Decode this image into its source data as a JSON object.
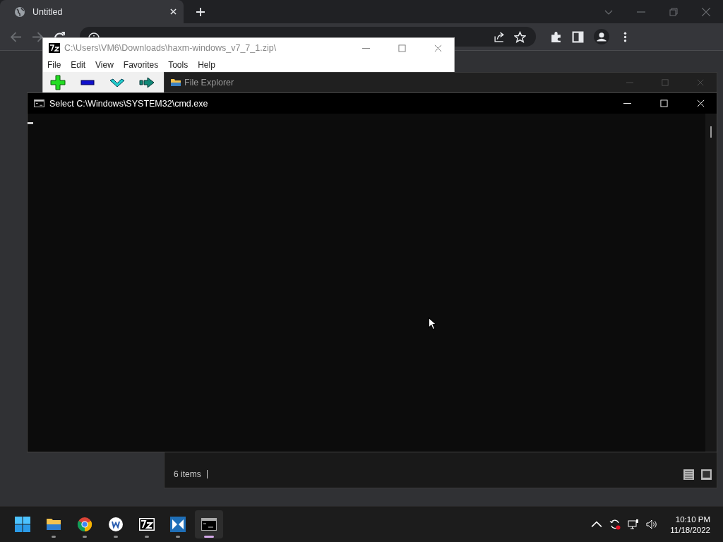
{
  "browser": {
    "tab": {
      "title": "Untitled",
      "selected": true
    }
  },
  "archive_window": {
    "title": "C:\\Users\\VM6\\Downloads\\haxm-windows_v7_7_1.zip\\",
    "menu": [
      "File",
      "Edit",
      "View",
      "Favorites",
      "Tools",
      "Help"
    ]
  },
  "explorer_window": {
    "title": "File Explorer",
    "status": "6 items"
  },
  "console_window": {
    "title": "Select C:\\Windows\\SYSTEM32\\cmd.exe"
  },
  "taskbar": {
    "apps": [
      {
        "kind": "start",
        "running": false,
        "selected": false
      },
      {
        "kind": "folder",
        "running": true,
        "selected": false
      },
      {
        "kind": "chrome",
        "running": true,
        "selected": false
      },
      {
        "kind": "writer",
        "running": true,
        "selected": false
      },
      {
        "kind": "sevenzip",
        "running": true,
        "selected": false
      },
      {
        "kind": "studio",
        "running": true,
        "selected": false
      },
      {
        "kind": "terminal",
        "running": true,
        "selected": true
      }
    ],
    "time": "10:10 PM",
    "date": "11/18/2022"
  }
}
